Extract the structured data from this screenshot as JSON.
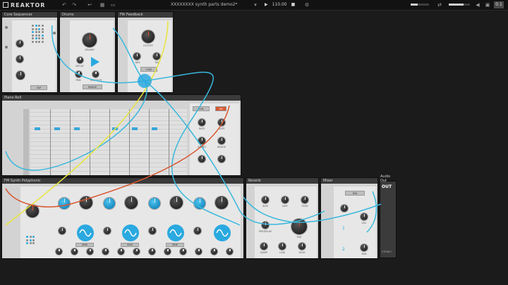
{
  "app": {
    "name": "REAKTOR"
  },
  "toolbar": {
    "filename": "XXXXXXXX synth parts demo2*",
    "tempo": "110.00",
    "play_icon": "play-icon",
    "stop_icon": "stop-icon",
    "volume_label": "0.1"
  },
  "modules": {
    "core_sequencer": {
      "title": "Core Sequencer",
      "button": "TAP"
    },
    "drums": {
      "title": "Drums",
      "knob1": "DRUMS",
      "knob2": "DECAY",
      "knob3": "PAN",
      "knob4": "VELOCITY",
      "select": "RANGE"
    },
    "filt_feedback": {
      "title": "Filt Feedback",
      "knob1": "CUTOFF",
      "knob2": "RES",
      "knob3": "MIX",
      "btn": "LOW"
    },
    "piano_roll": {
      "title": "Piano Roll",
      "btn1": "SYN",
      "btn2": "ON",
      "k1": "RATE",
      "k2": "GATE",
      "k3": "SWING",
      "k4": "RANGE"
    },
    "fm_synth": {
      "title": "FM Synth Polyphonic",
      "k1": "ATTACK",
      "k2": "DECAY",
      "k3": "SUSTAIN",
      "k4": "RELEASE",
      "k5": "RATIO",
      "k6": "AMOUNT",
      "k7": "INDEX",
      "k8": "FEEDBK",
      "k9": "DETUNE",
      "k10": "VIBRATO",
      "k11": "ATTACK",
      "k12": "DECAY",
      "k13": "SUSTAIN",
      "k14": "RELEASE",
      "sel": "SINE"
    },
    "reverb": {
      "title": "Reverb",
      "k1": "SIZE",
      "k2": "DIFF",
      "k3": "FEED",
      "k4": "PREDELAY",
      "k5": "MIX",
      "k6": "DAMP",
      "k7": "LOW",
      "k8": "HIGH"
    },
    "mixer": {
      "title": "Mixer",
      "btn": "MIX",
      "k1": "VOL",
      "k2": "PAN"
    },
    "audio_out": {
      "title": "Audio Out",
      "label": "OUT",
      "footer": "STEREO"
    }
  },
  "colors": {
    "accent": "#2aa9e0",
    "cable_blue": "#39b8dc",
    "cable_yellow": "#e8e43a",
    "cable_red": "#d8562e"
  }
}
